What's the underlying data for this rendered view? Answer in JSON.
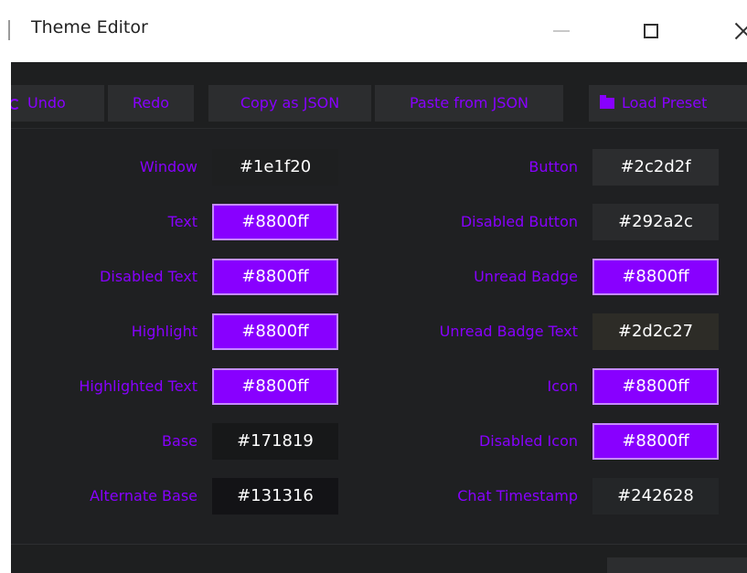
{
  "window": {
    "title": "Theme Editor"
  },
  "icons": {
    "undo": "undo-icon",
    "folder": "folder-icon",
    "minimize": "minimize-icon",
    "maximize": "maximize-icon",
    "close": "close-icon"
  },
  "toolbar": {
    "undo_label": "Undo",
    "redo_label": "Redo",
    "copy_label": "Copy as JSON",
    "paste_label": "Paste from JSON",
    "load_label": "Load Preset"
  },
  "colors": {
    "accent": "#8800ff",
    "background": "#1e1f20",
    "button": "#2c2d2f"
  },
  "left_fields": [
    {
      "label": "Window",
      "value": "#1e1f20",
      "bg": "#1e1f20",
      "purple": false
    },
    {
      "label": "Text",
      "value": "#8800ff",
      "bg": "#8800ff",
      "purple": true
    },
    {
      "label": "Disabled Text",
      "value": "#8800ff",
      "bg": "#8800ff",
      "purple": true
    },
    {
      "label": "Highlight",
      "value": "#8800ff",
      "bg": "#8800ff",
      "purple": true
    },
    {
      "label": "Highlighted Text",
      "value": "#8800ff",
      "bg": "#8800ff",
      "purple": true
    },
    {
      "label": "Base",
      "value": "#171819",
      "bg": "#171819",
      "purple": false
    },
    {
      "label": "Alternate Base",
      "value": "#131316",
      "bg": "#131316",
      "purple": false
    }
  ],
  "right_fields": [
    {
      "label": "Button",
      "value": "#2c2d2f",
      "bg": "#2c2d2f",
      "purple": false
    },
    {
      "label": "Disabled Button",
      "value": "#292a2c",
      "bg": "#292a2c",
      "purple": false
    },
    {
      "label": "Unread Badge",
      "value": "#8800ff",
      "bg": "#8800ff",
      "purple": true
    },
    {
      "label": "Unread Badge Text",
      "value": "#2d2c27",
      "bg": "#2d2c27",
      "purple": false
    },
    {
      "label": "Icon",
      "value": "#8800ff",
      "bg": "#8800ff",
      "purple": true
    },
    {
      "label": "Disabled Icon",
      "value": "#8800ff",
      "bg": "#8800ff",
      "purple": true
    },
    {
      "label": "Chat Timestamp",
      "value": "#242628",
      "bg": "#242628",
      "purple": false
    }
  ]
}
